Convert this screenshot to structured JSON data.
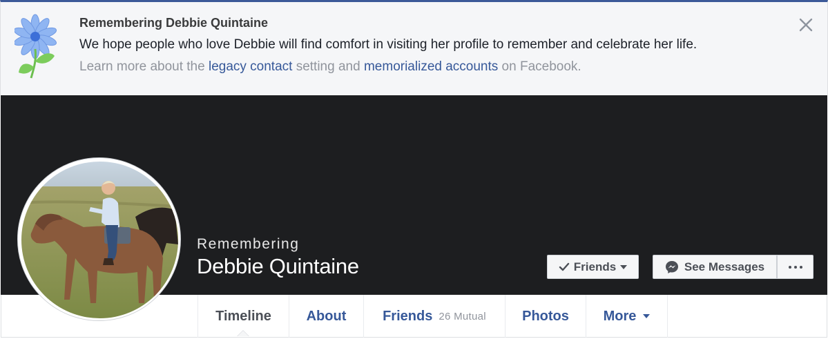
{
  "memorial_banner": {
    "title": "Remembering Debbie Quintaine",
    "message": "We hope people who love Debbie will find comfort in visiting her profile to remember and celebrate her life.",
    "learn_prefix": "Learn more about the ",
    "legacy_link": "legacy contact",
    "learn_middle": " setting and ",
    "memorialized_link": "memorialized accounts",
    "learn_suffix": " on Facebook.",
    "icon": "flower-icon",
    "close_icon": "close-icon"
  },
  "profile": {
    "remembering_label": "Remembering",
    "name": "Debbie Quintaine",
    "avatar_description": "profile-photo"
  },
  "actions": {
    "friends_label": "Friends",
    "messages_label": "See Messages",
    "more_label": "···"
  },
  "tabs": [
    {
      "label": "Timeline",
      "active": true
    },
    {
      "label": "About"
    },
    {
      "label": "Friends",
      "sub": "26 Mutual"
    },
    {
      "label": "Photos"
    },
    {
      "label": "More"
    }
  ],
  "colors": {
    "brand_blue": "#3b5998",
    "link_blue": "#365899",
    "cover": "#1d1e20"
  }
}
